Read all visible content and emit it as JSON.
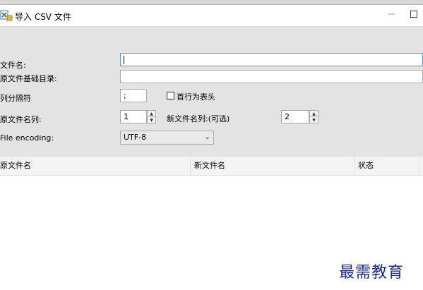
{
  "window": {
    "title": "导入 CSV 文件"
  },
  "form": {
    "filename_label": "文件名:",
    "source_dir_label": "原文件基础目录:",
    "separator_label": "列分隔符",
    "separator_value": ";",
    "header_checkbox_label": "首行为表头",
    "header_checked": false,
    "source_col_label": "原文件名列:",
    "source_col_value": "1",
    "new_col_label": "新文件名列:(可选)",
    "new_col_value": "2",
    "encoding_label": "File encoding:",
    "encoding_value": "UTF-8"
  },
  "grid": {
    "columns": [
      "原文件名",
      "新文件名",
      "状态"
    ]
  },
  "watermark": "最需教育"
}
